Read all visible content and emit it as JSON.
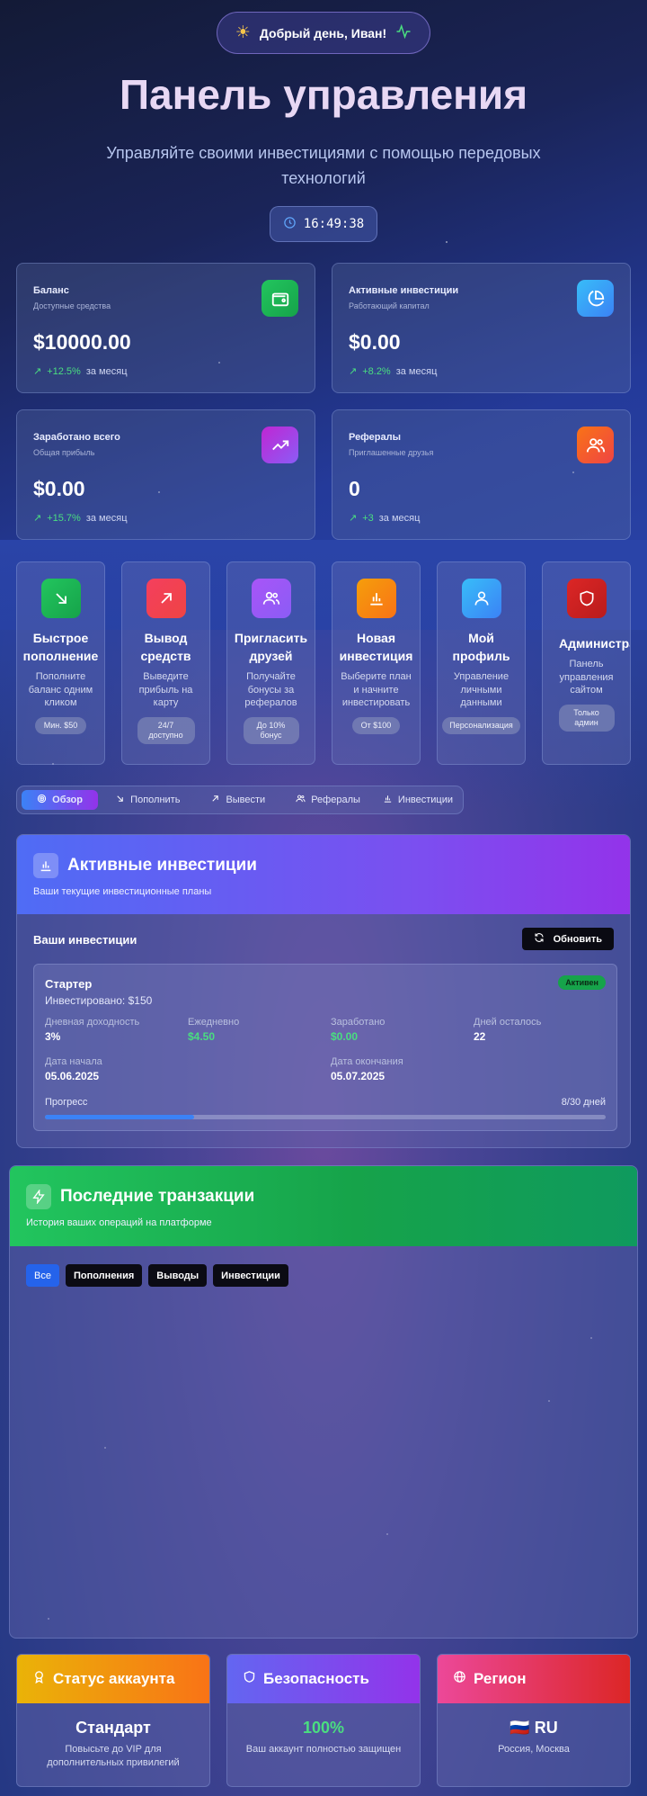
{
  "header": {
    "greeting": "Добрый день, Иван!",
    "title": "Панель управления",
    "subtitle": "Управляйте своими инвестициями с помощью передовых технологий",
    "clock": "16:49:38"
  },
  "stats": [
    {
      "label": "Баланс",
      "sub": "Доступные средства",
      "value": "$10000.00",
      "change": "+12.5%",
      "period": "за месяц",
      "icon": "wallet-icon",
      "color": "#22c55e"
    },
    {
      "label": "Активные инвестиции",
      "sub": "Работающий капитал",
      "value": "$0.00",
      "change": "+8.2%",
      "period": "за месяц",
      "icon": "pie-chart-icon",
      "color": "#3b82f6"
    },
    {
      "label": "Заработано всего",
      "sub": "Общая прибыль",
      "value": "$0.00",
      "change": "+15.7%",
      "period": "за месяц",
      "icon": "trending-up-icon",
      "color": "#a855f7"
    },
    {
      "label": "Рефералы",
      "sub": "Приглашенные друзья",
      "value": "0",
      "change": "+3",
      "period": "за месяц",
      "icon": "users-icon",
      "color": "#f97316"
    }
  ],
  "actions": [
    {
      "name": "Быстрое пополнение",
      "desc": "Пополните баланс одним кликом",
      "badge": "Мин. $50",
      "icon": "arrow-down-right-icon",
      "color": "#22c55e"
    },
    {
      "name": "Вывод средств",
      "desc": "Выведите прибыль на карту",
      "badge": "24/7 доступно",
      "icon": "arrow-up-right-icon",
      "color": "#ef4444"
    },
    {
      "name": "Пригласить друзей",
      "desc": "Получайте бонусы за рефералов",
      "badge": "До 10% бонус",
      "icon": "users-icon",
      "color": "#a855f7"
    },
    {
      "name": "Новая инвестиция",
      "desc": "Выберите план и начните инвестировать",
      "badge": "От $100",
      "icon": "bar-chart-icon",
      "color": "#f59e0b"
    },
    {
      "name": "Мой профиль",
      "desc": "Управление личными данными",
      "badge": "Персонализация",
      "icon": "user-icon",
      "color": "#3b82f6"
    },
    {
      "name": "Администратор",
      "desc": "Панель управления сайтом",
      "badge": "Только админ",
      "icon": "shield-icon",
      "color": "#dc2626"
    }
  ],
  "tabs": [
    {
      "label": "Обзор",
      "icon": "target-icon"
    },
    {
      "label": "Пополнить",
      "icon": "arrow-down-right-icon"
    },
    {
      "label": "Вывести",
      "icon": "arrow-up-right-icon"
    },
    {
      "label": "Рефералы",
      "icon": "users-icon"
    },
    {
      "label": "Инвестиции",
      "icon": "bar-chart-icon"
    }
  ],
  "investments": {
    "title": "Активные инвестиции",
    "subtitle": "Ваши текущие инвестиционные планы",
    "section_title": "Ваши инвестиции",
    "refresh": "Обновить",
    "item": {
      "plan": "Стартер",
      "invested": "Инвестировано: $150",
      "status": "Активен",
      "daily_yield_label": "Дневная доходность",
      "daily_yield": "3%",
      "daily_label": "Ежедневно",
      "daily": "$4.50",
      "earned_label": "Заработано",
      "earned": "$0.00",
      "days_left_label": "Дней осталось",
      "days_left": "22",
      "start_label": "Дата начала",
      "start": "05.06.2025",
      "end_label": "Дата окончания",
      "end": "05.07.2025",
      "progress_label": "Прогресс",
      "progress_text": "8/30 дней",
      "progress_fraction": 0.2667
    }
  },
  "transactions": {
    "title": "Последние транзакции",
    "subtitle": "История ваших операций на платформе",
    "filters": [
      "Все",
      "Пополнения",
      "Выводы",
      "Инвестиции"
    ]
  },
  "bottom": [
    {
      "title": "Статус аккаунта",
      "value": "Стандарт",
      "desc": "Повысьте до VIP для дополнительных привилегий",
      "icon": "award-icon"
    },
    {
      "title": "Безопасность",
      "value": "100%",
      "desc": "Ваш аккаунт полностью защищен",
      "icon": "shield-icon"
    },
    {
      "title": "Регион",
      "value": "🇷🇺 RU",
      "desc": "Россия, Москва",
      "icon": "globe-icon"
    }
  ]
}
